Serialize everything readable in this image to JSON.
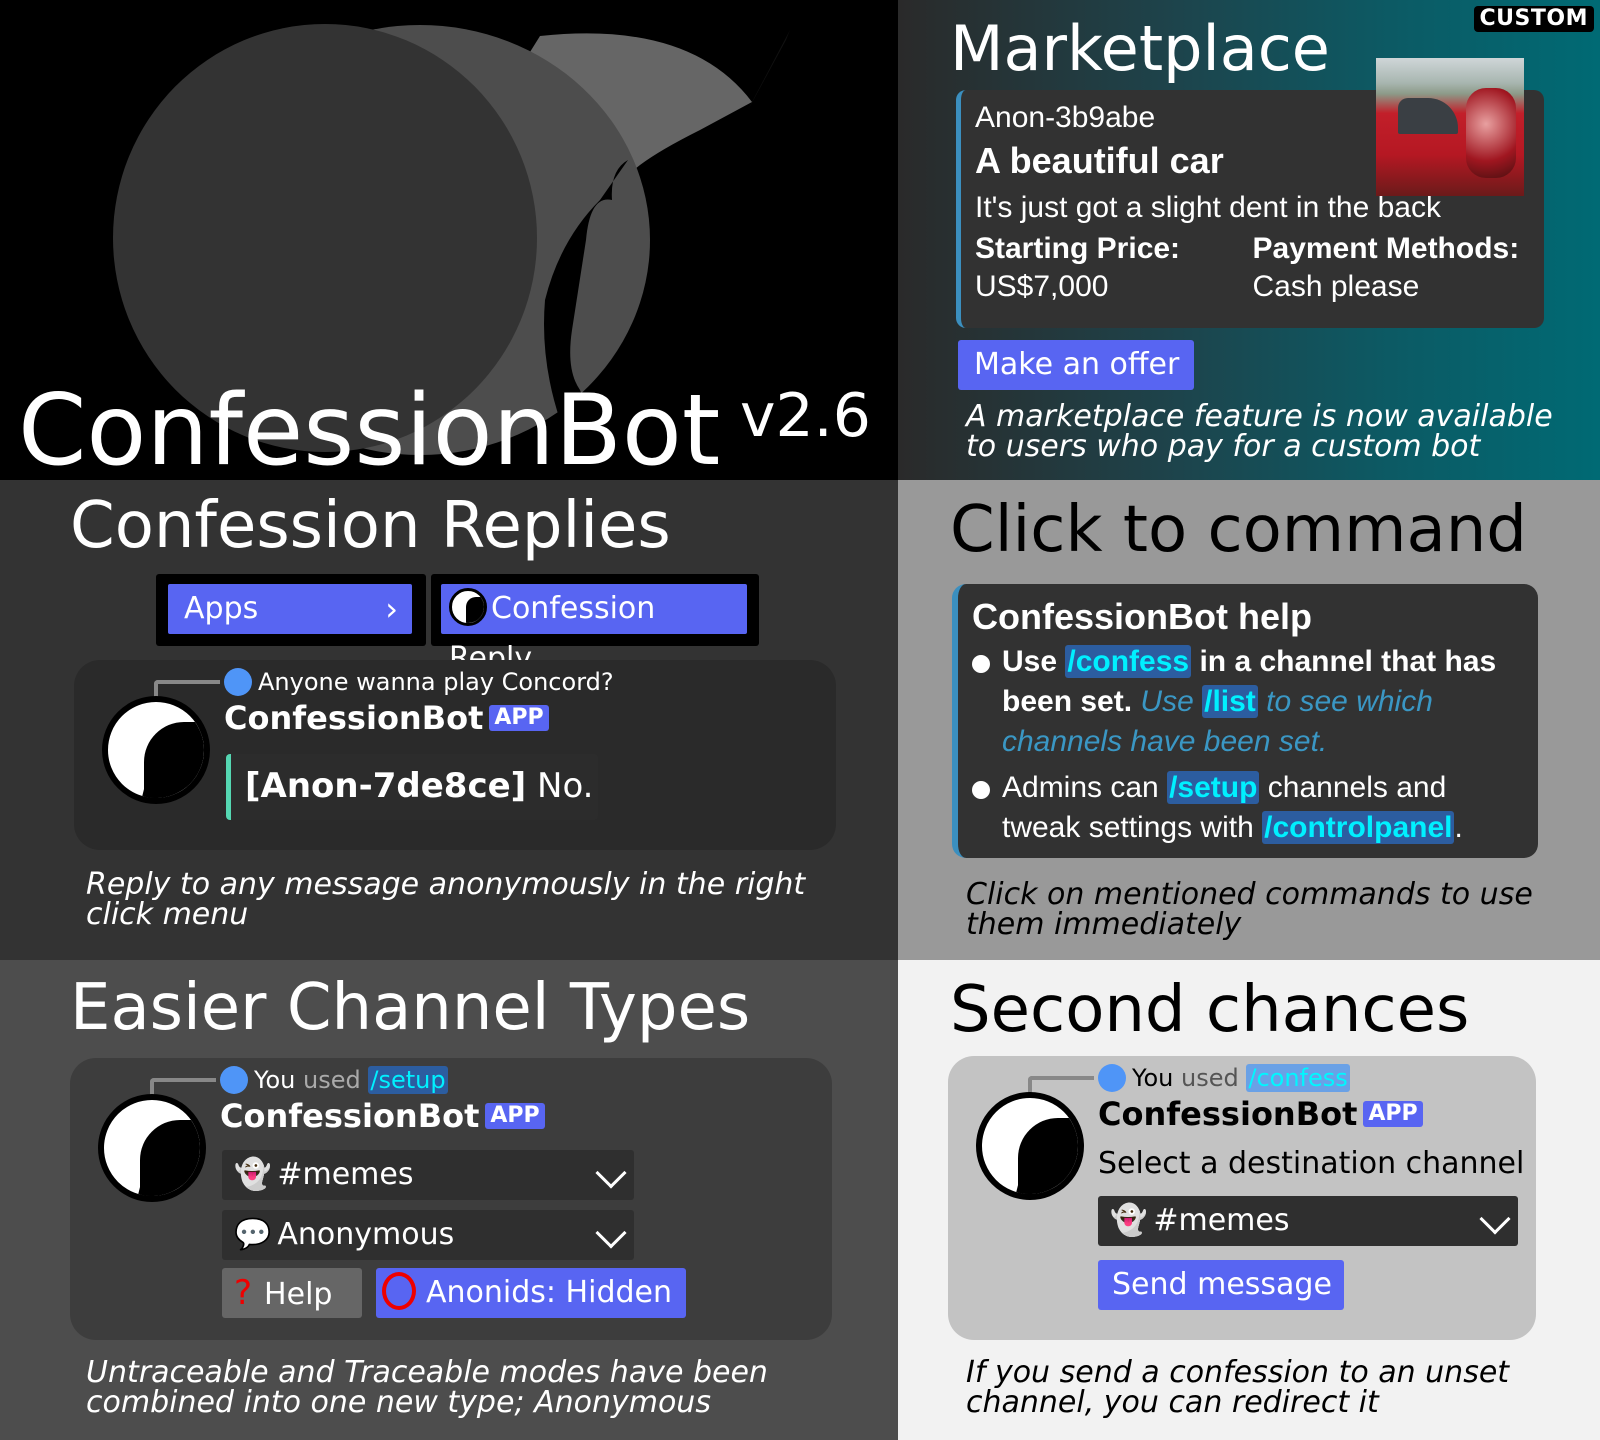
{
  "hero": {
    "title": "ConfessionBot",
    "version": "v2.6"
  },
  "marketplace": {
    "heading": "Marketplace",
    "badge": "CUSTOM",
    "card": {
      "author": "Anon-3b9abe",
      "title": "A beautiful car",
      "description": "It's just got a slight dent in the back",
      "fields": [
        {
          "name": "Starting Price:",
          "value": "US$7,000"
        },
        {
          "name": "Payment Methods:",
          "value": "Cash please"
        }
      ],
      "thumbnail": "red-car-with-dent-photo"
    },
    "button_label": "Make an offer",
    "caption": "A marketplace feature is now available to users who pay for a custom bot"
  },
  "replies": {
    "heading": "Confession Replies",
    "menu": {
      "apps_label": "Apps",
      "reply_label": "Confession Reply"
    },
    "message": {
      "referenced_text": "Anyone wanna play Concord?",
      "bot_name": "ConfessionBot",
      "app_tag": "APP",
      "anon_id": "[Anon-7de8ce]",
      "reply_text": "No."
    },
    "caption": "Reply to any message anonymously in the right click menu"
  },
  "click": {
    "heading": "Click to command",
    "card": {
      "title": "ConfessionBot help",
      "item1": {
        "pre": "Use",
        "cmd": "/confess",
        "post": "in a channel that has been set.",
        "note_pre": "Use",
        "note_cmd": "/list",
        "note_post": "to see which channels have been set."
      },
      "item2": {
        "pre": "Admins can",
        "cmd": "/setup",
        "mid": "channels and tweak settings with",
        "cmd2": "/controlpanel",
        "post": "."
      }
    },
    "caption": "Click on mentioned commands to use them immediately"
  },
  "types": {
    "heading": "Easier Channel Types",
    "message": {
      "you_used": "You used",
      "used": "used",
      "command": "/setup",
      "bot_name": "ConfessionBot",
      "app_tag": "APP",
      "channel_select": "#memes",
      "type_select": "Anonymous",
      "help_button": "Help",
      "anonids_button": "Anonids: Hidden"
    },
    "caption": "Untraceable and Traceable modes have been combined into one new type; Anonymous"
  },
  "second": {
    "heading": "Second chances",
    "message": {
      "you_used": "You used",
      "command": "/confess",
      "bot_name": "ConfessionBot",
      "app_tag": "APP",
      "prompt": "Select a destination channel",
      "channel_select": "#memes",
      "send_button": "Send message"
    },
    "caption": "If you send a confession to an unset channel, you can redirect it"
  },
  "colors": {
    "blurple": "#5865f2",
    "command_bg": "#2c5da0",
    "command_text": "#00f0ff",
    "embed_accent": "#3b8fbf",
    "reply_accent": "#55d7b2",
    "ref_dot": "#4f95f7",
    "teal": "#006a74"
  }
}
